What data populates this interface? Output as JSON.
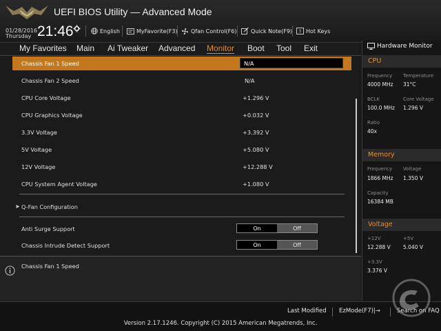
{
  "header": {
    "app_title": "UEFI BIOS Utility — Advanced Mode",
    "date": "01/28/2016",
    "day": "Thursday",
    "time": "21:46",
    "language": "English",
    "my_favorite": "MyFavorite(F3)",
    "qfan": "Qfan Control(F6)",
    "quick_note": "Quick Note(F9)",
    "hotkeys": "Hot Keys"
  },
  "nav": {
    "tabs": [
      "My Favorites",
      "Main",
      "Ai Tweaker",
      "Advanced",
      "Monitor",
      "Boot",
      "Tool",
      "Exit"
    ],
    "active": "Monitor"
  },
  "main": {
    "rows": [
      {
        "label": "Chassis Fan 1 Speed",
        "value": "N/A"
      },
      {
        "label": "Chassis Fan 2 Speed",
        "value": "N/A"
      },
      {
        "label": "CPU Core Voltage",
        "value": "+1.296 V"
      },
      {
        "label": "CPU Graphics Voltage",
        "value": "+0.032 V"
      },
      {
        "label": "3.3V Voltage",
        "value": "+3.392 V"
      },
      {
        "label": "5V Voltage",
        "value": "+5.080 V"
      },
      {
        "label": "12V Voltage",
        "value": "+12.288 V"
      },
      {
        "label": "CPU System Agent Voltage",
        "value": "+1.080 V"
      }
    ],
    "submenu": {
      "label": "Q-Fan Configuration"
    },
    "toggles": [
      {
        "label": "Anti Surge Support",
        "on": "On",
        "off": "Off",
        "selected": "On"
      },
      {
        "label": "Chassis Intrude Detect Support",
        "on": "On",
        "off": "Off",
        "selected": "On"
      }
    ]
  },
  "help": {
    "text": "Chassis Fan 1 Speed"
  },
  "hardware_monitor": {
    "title": "Hardware Monitor",
    "cpu": {
      "title": "CPU",
      "frequency_label": "Frequency",
      "frequency_value": "4000 MHz",
      "temperature_label": "Temperature",
      "temperature_value": "31°C",
      "bclk_label": "BCLK",
      "bclk_value": "100.0 MHz",
      "core_voltage_label": "Core Voltage",
      "core_voltage_value": "1.296 V",
      "ratio_label": "Ratio",
      "ratio_value": "40x"
    },
    "memory": {
      "title": "Memory",
      "frequency_label": "Frequency",
      "frequency_value": "1866 MHz",
      "voltage_label": "Voltage",
      "voltage_value": "1.350 V",
      "capacity_label": "Capacity",
      "capacity_value": "16384 MB"
    },
    "voltage": {
      "title": "Voltage",
      "v12_label": "+12V",
      "v12_value": "12.288 V",
      "v5_label": "+5V",
      "v5_value": "5.040 V",
      "v33_label": "+3.3V",
      "v33_value": "3.376 V"
    }
  },
  "footer": {
    "last_modified": "Last Modified",
    "ezmode": "EzMode(F7)|→",
    "search_faq": "Search on FAQ",
    "version": "Version 2.17.1246. Copyright (C) 2015 American Megatrends, Inc."
  },
  "colors": {
    "accent": "#c4781e",
    "active_tab": "#f08c00",
    "section_title": "#e8902a"
  }
}
